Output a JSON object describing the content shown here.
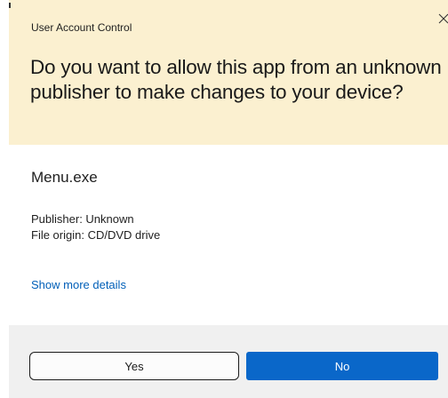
{
  "dialog": {
    "title": "User Account Control",
    "question": "Do you want to allow this app from an unknown publisher to make changes to your device?",
    "app_name": "Menu.exe",
    "publisher": "Publisher: Unknown",
    "file_origin": "File origin: CD/DVD drive",
    "details_link": "Show more details",
    "close_icon": "close-icon"
  },
  "buttons": {
    "yes_label": "Yes",
    "no_label": "No"
  },
  "colors": {
    "header_background": "#fbf0d0",
    "footer_background": "#f0f0f0",
    "primary_button": "#0a67c9",
    "link": "#005fb8"
  }
}
